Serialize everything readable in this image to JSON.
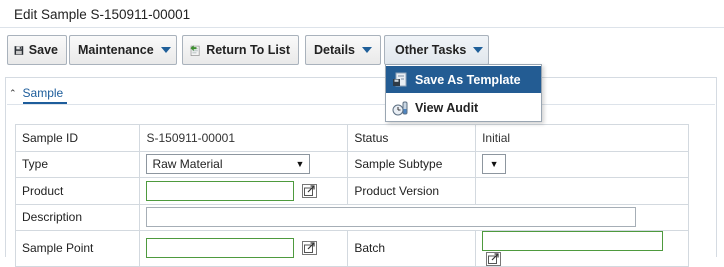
{
  "page": {
    "title": "Edit Sample S-150911-00001"
  },
  "toolbar": {
    "save_label": "Save",
    "maintenance_label": "Maintenance",
    "return_label": "Return To List",
    "details_label": "Details",
    "other_tasks_label": "Other Tasks"
  },
  "menu": {
    "items": [
      {
        "label": "Save As Template",
        "icon": "template-icon"
      },
      {
        "label": "View Audit",
        "icon": "audit-icon"
      }
    ]
  },
  "section": {
    "title": "Sample"
  },
  "form": {
    "sample_id_label": "Sample ID",
    "sample_id_value": "S-150911-00001",
    "status_label": "Status",
    "status_value": "Initial",
    "type_label": "Type",
    "type_value": "Raw Material",
    "subtype_label": "Sample Subtype",
    "subtype_value": "",
    "product_label": "Product",
    "product_version_label": "Product Version",
    "description_label": "Description",
    "sample_point_label": "Sample Point",
    "batch_label": "Batch"
  },
  "colors": {
    "accent": "#235c93",
    "required_border": "#4e9a3e"
  }
}
